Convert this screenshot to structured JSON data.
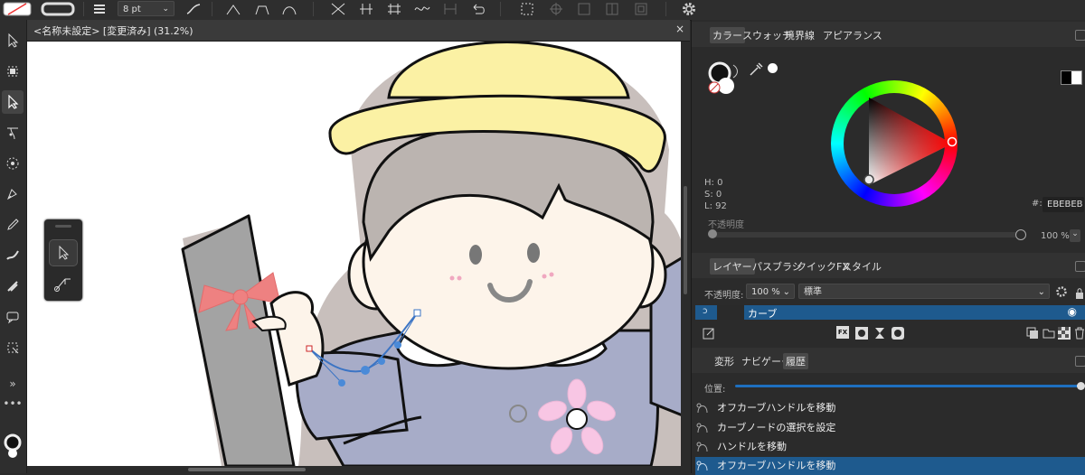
{
  "toolbar": {
    "stroke_width": "8 pt",
    "colors": {
      "fill": "#ffffff",
      "stroke": "#1a1a1a"
    }
  },
  "document": {
    "title": "<名称未設定> [変更済み] (31.2%)",
    "close": "×"
  },
  "tools": [
    "move-tool",
    "artboard-tool",
    "node-tool",
    "point-transform-tool",
    "corner-tool",
    "pen-tool",
    "pencil-tool",
    "vector-brush-tool",
    "fill-tool",
    "speech-bubble-tool",
    "crop-tool",
    "more-tools"
  ],
  "color_panel": {
    "tabs": [
      "カラー",
      "スウォッチ",
      "境界線",
      "アピアランス"
    ],
    "active_tab": "カラー",
    "hsl": {
      "h": "H: 0",
      "s": "S: 0",
      "l": "L: 92"
    },
    "hex_label": "#:",
    "hex": "EBEBEB",
    "opacity_label": "不透明度",
    "opacity_value": "100 %"
  },
  "layers_panel": {
    "tabs": [
      "レイヤー",
      "パスブラシ",
      "クイックFX",
      "スタイル"
    ],
    "active_tab": "レイヤー",
    "opacity_label": "不透明度:",
    "opacity_value": "100 %",
    "blend_mode": "標準",
    "layer_name": "カーブ",
    "layer_icon_text": "FX"
  },
  "history_panel": {
    "tabs": [
      "変形",
      "ナビゲータ",
      "履歴"
    ],
    "active_tab": "履歴",
    "position_label": "位置:",
    "items": [
      "オフカーブハンドルを移動",
      "カーブノードの選択を設定",
      "ハンドルを移動",
      "オフカーブハンドルを移動"
    ],
    "selected_index": 3
  },
  "colors": {
    "accent": "#1e5a8e",
    "hat": "#fbf1a4",
    "hair": "#bbb4b0",
    "skin": "#fdf4ea",
    "uniform": "#a7acc8",
    "shadow": "#c8bfbc",
    "flower": "#f8c6e4",
    "ribbon": "#ee8181",
    "tube": "#a3a3a3"
  }
}
